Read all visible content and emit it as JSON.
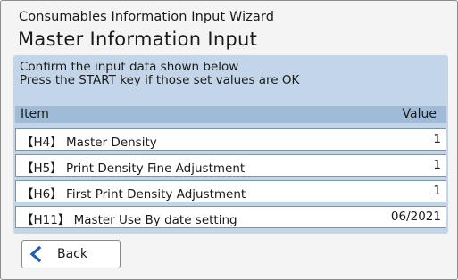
{
  "header": {
    "wizard_name": "Consumables Information Input Wizard",
    "screen_title": "Master Information Input"
  },
  "instructions": {
    "line1": "Confirm the input data shown below",
    "line2": "Press the START key if those set values are OK"
  },
  "table": {
    "col_item": "Item",
    "col_value": "Value",
    "rows": [
      {
        "item": "【H4】 Master Density",
        "value": "1"
      },
      {
        "item": "【H5】 Print Density Fine Adjustment",
        "value": "1"
      },
      {
        "item": "【H6】 First Print Density Adjustment",
        "value": "1"
      },
      {
        "item": "【H11】 Master Use By date setting",
        "value": "06/2021"
      }
    ]
  },
  "back_button": {
    "label": "Back",
    "icon": "chevron-left-icon"
  },
  "colors": {
    "panel_bg": "#c3d5e8",
    "header_bg": "#9fbbd7",
    "chevron": "#1f5fb3"
  }
}
